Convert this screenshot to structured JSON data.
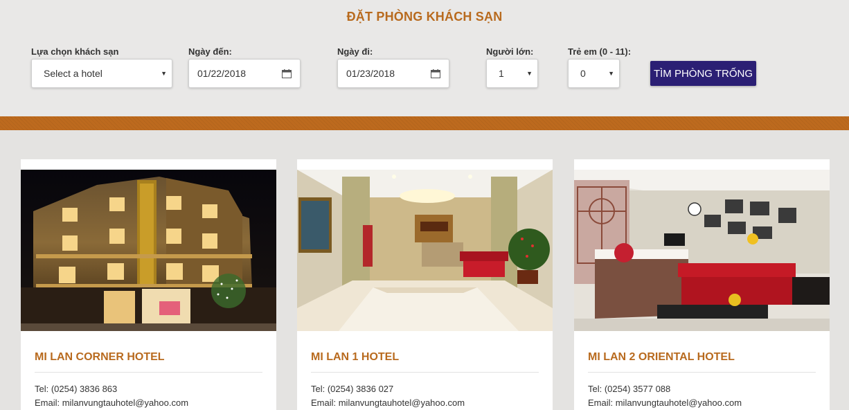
{
  "booking": {
    "title": "ĐẶT PHÒNG KHÁCH SẠN",
    "hotel_label": "Lựa chọn khách sạn",
    "hotel_value": "Select a hotel",
    "arrival_label": "Ngày đến:",
    "arrival_value": "01/22/2018",
    "departure_label": "Ngày đi:",
    "departure_value": "01/23/2018",
    "adults_label": "Người lớn:",
    "adults_value": "1",
    "children_label": "Trẻ em (0 - 11):",
    "children_value": "0",
    "search_label": "TÌM PHÒNG TRỐNG"
  },
  "colors": {
    "accent": "#b86a1e",
    "band": "#bd6a1e",
    "button": "#2b1f74",
    "page_bg": "#e8e7e6"
  },
  "icons": [
    "chevron-down-icon",
    "calendar-icon"
  ],
  "hotels": [
    {
      "name": "MI LAN CORNER HOTEL",
      "tel": "Tel: (0254) 3836 863",
      "email": "Email: milanvungtauhotel@yahoo.com"
    },
    {
      "name": "MI LAN 1 HOTEL",
      "tel": "Tel: (0254) 3836 027",
      "email": "Email: milanvungtauhotel@yahoo.com"
    },
    {
      "name": "MI LAN 2 ORIENTAL HOTEL",
      "tel": "Tel: (0254) 3577 088",
      "email": "Email: milanvungtauhotel@yahoo.com"
    }
  ]
}
